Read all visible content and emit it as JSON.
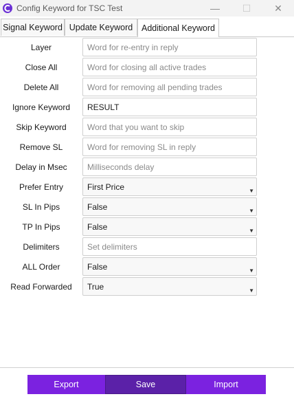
{
  "window": {
    "title": "Config Keyword for TSC Test",
    "minimize": "—",
    "maximize": "☐",
    "close": "✕"
  },
  "tabs": [
    {
      "label": "Signal Keyword"
    },
    {
      "label": "Update Keyword"
    },
    {
      "label": "Additional Keyword"
    }
  ],
  "form": {
    "layer": {
      "label": "Layer",
      "value": "",
      "placeholder": "Word for re-entry in reply"
    },
    "close_all": {
      "label": "Close All",
      "value": "",
      "placeholder": "Word for closing all active trades"
    },
    "delete_all": {
      "label": "Delete All",
      "value": "",
      "placeholder": "Word for removing all pending trades"
    },
    "ignore_keyword": {
      "label": "Ignore Keyword",
      "value": "RESULT",
      "placeholder": ""
    },
    "skip_keyword": {
      "label": "Skip Keyword",
      "value": "",
      "placeholder": "Word that you want to skip"
    },
    "remove_sl": {
      "label": "Remove SL",
      "value": "",
      "placeholder": "Word for removing SL in reply"
    },
    "delay": {
      "label": "Delay in Msec",
      "value": "",
      "placeholder": "Milliseconds delay"
    },
    "prefer_entry": {
      "label": "Prefer Entry",
      "value": "First Price"
    },
    "sl_in_pips": {
      "label": "SL In Pips",
      "value": "False"
    },
    "tp_in_pips": {
      "label": "TP In Pips",
      "value": "False"
    },
    "delimiters": {
      "label": "Delimiters",
      "value": "",
      "placeholder": "Set delimiters"
    },
    "all_order": {
      "label": "ALL Order",
      "value": "False"
    },
    "read_forwarded": {
      "label": "Read Forwarded",
      "value": "True"
    }
  },
  "buttons": {
    "export": "Export",
    "save": "Save",
    "import": "Import"
  },
  "icons": {
    "app": "app-logo-icon",
    "dropdown": "dropdown-arrow-icon"
  },
  "colors": {
    "accent": "#7b22e0",
    "accent_dark": "#5b21a8"
  }
}
